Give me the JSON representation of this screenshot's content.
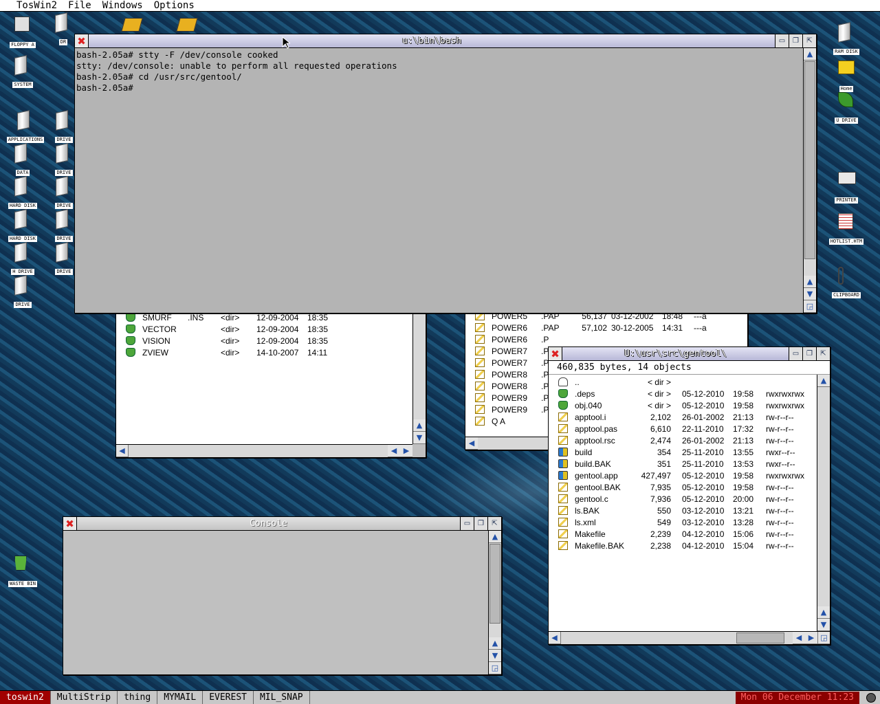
{
  "menubar": {
    "app": "TosWin2",
    "items": [
      "File",
      "Windows",
      "Options"
    ]
  },
  "desktop_icons": {
    "floppy": "FLOPPY A",
    "dr": "DR",
    "system": "SYSTEM",
    "applications": "APPLICATIONS",
    "data": "DATA",
    "hard_disk_1": "HARD DISK",
    "hard_disk_2": "HARD DISK",
    "h_drive": "H DRIVE",
    "drive": "DRIVE",
    "drive_col2": "DRIVE",
    "ram_disk": "RAM DISK",
    "home": "Home",
    "u_drive": "U DRIVE",
    "printer": "PRINTER",
    "hotlist": "HOTLIST.HTM",
    "clipboard": "CLIPBOARD",
    "waste_bin": "WASTE BIN"
  },
  "terminal": {
    "title": "u:\\bin\\bash",
    "lines": "bash-2.05a# stty -F /dev/console cooked\nstty: /dev/console: unable to perform all requested operations\nbash-2.05a# cd /usr/src/gentool/\nbash-2.05a#"
  },
  "left_window": {
    "rows": [
      {
        "name": "SMURF",
        "ext": ".INS",
        "size": "<dir>",
        "date": "12-09-2004",
        "time": "18:35"
      },
      {
        "name": "VECTOR",
        "ext": "",
        "size": "<dir>",
        "date": "12-09-2004",
        "time": "18:35"
      },
      {
        "name": "VISION",
        "ext": "",
        "size": "<dir>",
        "date": "12-09-2004",
        "time": "18:35"
      },
      {
        "name": "ZVIEW",
        "ext": "",
        "size": "<dir>",
        "date": "14-10-2007",
        "time": "14:11"
      }
    ]
  },
  "middle_window": {
    "rows": [
      {
        "name": "POWER5",
        "ext": ".PAP",
        "size": "56,137",
        "date": "03-12-2002",
        "time": "18:48",
        "attr": "---a"
      },
      {
        "name": "POWER6",
        "ext": ".PAP",
        "size": "57,102",
        "date": "30-12-2005",
        "time": "14:31",
        "attr": "---a"
      },
      {
        "name": "POWER6",
        "ext": ".P"
      },
      {
        "name": "POWER7",
        "ext": ".P"
      },
      {
        "name": "POWER7",
        "ext": ".P"
      },
      {
        "name": "POWER8",
        "ext": ".P"
      },
      {
        "name": "POWER8",
        "ext": ".P"
      },
      {
        "name": "POWER9",
        "ext": ".P"
      },
      {
        "name": "POWER9",
        "ext": ".P"
      },
      {
        "name": "Q A",
        "ext": ""
      }
    ]
  },
  "gentool_window": {
    "title": "U:\\usr\\src\\gentool\\",
    "info": "460,835 bytes, 14 objects",
    "rows": [
      {
        "icon": "up",
        "name": "..",
        "size": "< dir >",
        "date": "",
        "time": "",
        "perm": ""
      },
      {
        "icon": "folder",
        "name": ".deps",
        "size": "< dir >",
        "date": "05-12-2010",
        "time": "19:58",
        "perm": "rwxrwxrwx"
      },
      {
        "icon": "folder",
        "name": "obj.040",
        "size": "< dir >",
        "date": "05-12-2010",
        "time": "19:58",
        "perm": "rwxrwxrwx"
      },
      {
        "icon": "file",
        "name": "apptool.i",
        "size": "2,102",
        "date": "26-01-2002",
        "time": "21:13",
        "perm": "rw-r--r--"
      },
      {
        "icon": "file",
        "name": "apptool.pas",
        "size": "6,610",
        "date": "22-11-2010",
        "time": "17:32",
        "perm": "rw-r--r--"
      },
      {
        "icon": "file",
        "name": "apptool.rsc",
        "size": "2,474",
        "date": "26-01-2002",
        "time": "21:13",
        "perm": "rw-r--r--"
      },
      {
        "icon": "prg",
        "name": "build",
        "size": "354",
        "date": "25-11-2010",
        "time": "13:55",
        "perm": "rwxr--r--"
      },
      {
        "icon": "prg",
        "name": "build.BAK",
        "size": "351",
        "date": "25-11-2010",
        "time": "13:53",
        "perm": "rwxr--r--"
      },
      {
        "icon": "prg",
        "name": "gentool.app",
        "size": "427,497",
        "date": "05-12-2010",
        "time": "19:58",
        "perm": "rwxrwxrwx"
      },
      {
        "icon": "file",
        "name": "gentool.BAK",
        "size": "7,935",
        "date": "05-12-2010",
        "time": "19:58",
        "perm": "rw-r--r--"
      },
      {
        "icon": "file",
        "name": "gentool.c",
        "size": "7,936",
        "date": "05-12-2010",
        "time": "20:00",
        "perm": "rw-r--r--"
      },
      {
        "icon": "file",
        "name": "ls.BAK",
        "size": "550",
        "date": "03-12-2010",
        "time": "13:21",
        "perm": "rw-r--r--"
      },
      {
        "icon": "file",
        "name": "ls.xml",
        "size": "549",
        "date": "03-12-2010",
        "time": "13:28",
        "perm": "rw-r--r--"
      },
      {
        "icon": "file",
        "name": "Makefile",
        "size": "2,239",
        "date": "04-12-2010",
        "time": "15:06",
        "perm": "rw-r--r--"
      },
      {
        "icon": "file",
        "name": "Makefile.BAK",
        "size": "2,238",
        "date": "04-12-2010",
        "time": "15:04",
        "perm": "rw-r--r--"
      }
    ]
  },
  "console_window": {
    "title": "Console"
  },
  "taskbar": {
    "items": [
      "toswin2",
      "MultiStrip",
      "thing",
      "MYMAIL",
      "EVEREST",
      "MIL_SNAP"
    ],
    "clock": "Mon 06 December 11:23"
  },
  "colors": {
    "taskbar_active": "#a00000",
    "clock_bg": "#8a0000",
    "title_active": "#b8b8d8"
  }
}
